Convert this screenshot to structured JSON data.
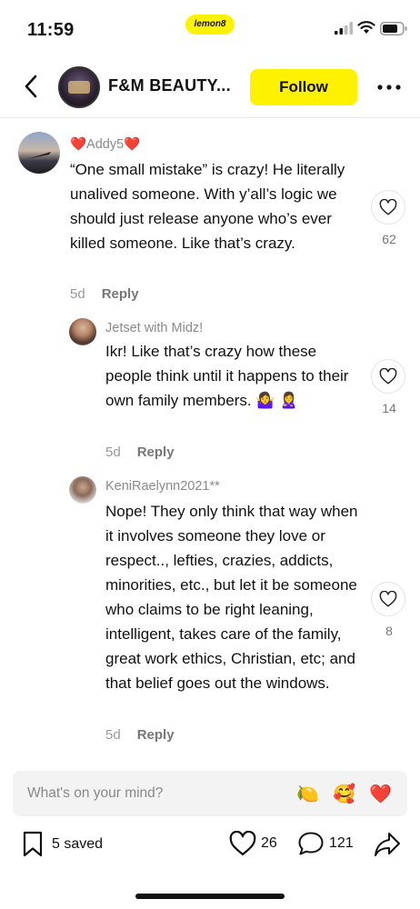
{
  "status": {
    "time": "11:59",
    "brand": "lemon8"
  },
  "header": {
    "title": "F&M BEAUTY...",
    "follow_label": "Follow"
  },
  "comments": [
    {
      "user": "❤️Addy5❤️",
      "text": "“One small mistake” is crazy! He literally unalived someone. With y’all’s logic we should just release anyone who’s ever killed someone. Like that’s crazy.",
      "time": "5d",
      "reply_label": "Reply",
      "likes": "62"
    },
    {
      "user": "Jetset with Midz!",
      "text": "Ikr! Like that’s crazy how these people think until it happens to their own family members. 🤷‍♀️ 🙎‍♀️",
      "time": "5d",
      "reply_label": "Reply",
      "likes": "14"
    },
    {
      "user": "KeniRaelynn2021**",
      "text": "Nope! They only think that way when it involves someone they love or respect.., lefties, crazies, addicts, minorities, etc., but let it be someone who claims to be right leaning, intelligent, takes care of the family, great work ethics, Christian, etc; and that belief goes out the windows.",
      "time": "5d",
      "reply_label": "Reply",
      "likes": "8"
    }
  ],
  "input": {
    "placeholder": "What's on your mind?",
    "emojis": [
      "🍋",
      "🥰",
      "❤️"
    ]
  },
  "bottom_bar": {
    "saved": "5 saved",
    "likes": "26",
    "comments": "121"
  },
  "colors": {
    "accent": "#fff200",
    "muted": "#8a8a8a"
  }
}
